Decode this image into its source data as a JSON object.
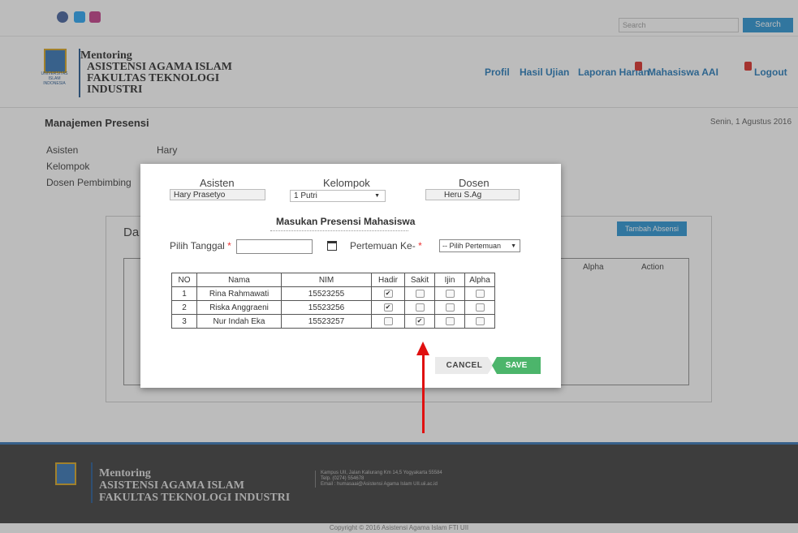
{
  "topbar": {
    "search_placeholder": "Search",
    "search_button": "Search"
  },
  "brand": {
    "line1": "Mentoring",
    "line2": "ASISTENSI AGAMA ISLAM",
    "line3": "FAKULTAS TEKNOLOGI",
    "line4": "INDUSTRI",
    "logo_text": "UNIVERSITAS ISLAM INDONESIA"
  },
  "nav": {
    "profil": "Profil",
    "hasil_ujian": "Hasil Ujian",
    "laporan_harian": "Laporan Harian",
    "mahasiswa_aai": "Mahasiswa AAI",
    "logout": "Logout"
  },
  "page": {
    "title": "Manajemen Presensi",
    "date": "Senin, 1 Agustus 2016"
  },
  "info": {
    "asisten_label": "Asisten",
    "asisten_value": "Hary",
    "kelompok_label": "Kelompok",
    "dosen_label": "Dosen Pembimbing"
  },
  "background": {
    "panel_title": "Da",
    "add_button": "Tambah Absensi",
    "col_alpha": "Alpha",
    "col_action": "Action"
  },
  "modal": {
    "asisten_label": "Asisten",
    "asisten_value": "Hary Prasetyo",
    "kelompok_label": "Kelompok",
    "kelompok_value": "1 Putri",
    "dosen_label": "Dosen",
    "dosen_value": "Heru S.Ag",
    "title": "Masukan Presensi Mahasiswa",
    "date_label": "Pilih Tanggal",
    "meeting_label": "Pertemuan Ke-",
    "meeting_select": "-- Pilih Pertemuan",
    "required_mark": "*",
    "columns": [
      "NO",
      "Nama",
      "NIM",
      "Hadir",
      "Sakit",
      "Ijin",
      "Alpha"
    ],
    "rows": [
      {
        "no": "1",
        "nama": "Rina Rahmawati",
        "nim": "15523255",
        "hadir": true,
        "sakit": false,
        "ijin": false,
        "alpha": false
      },
      {
        "no": "2",
        "nama": "Riska Anggraeni",
        "nim": "15523256",
        "hadir": true,
        "sakit": false,
        "ijin": false,
        "alpha": false
      },
      {
        "no": "3",
        "nama": "Nur Indah Eka",
        "nim": "15523257",
        "hadir": false,
        "sakit": true,
        "ijin": false,
        "alpha": false
      }
    ],
    "cancel": "CANCEL",
    "save": "SAVE"
  },
  "footer": {
    "line1": "Mentoring",
    "line2": "ASISTENSI AGAMA ISLAM",
    "line3": "FAKULTAS TEKNOLOGI INDUSTRI",
    "address1": "Kampus UII, Jalan Kaliurang Km 14,5 Yogyakarta 55584",
    "address2": "Telp. (0274) 554678",
    "address3": "Email : humasaai@Asistensi Agama Islam UII.uii.ac.id",
    "copyright": "Copyright © 2016 Asistensi Agama Islam FTI UII"
  },
  "colors": {
    "accent": "#1f8fd1",
    "save": "#4cb56b",
    "arrow": "#e01010",
    "footer_bg": "#333333"
  }
}
